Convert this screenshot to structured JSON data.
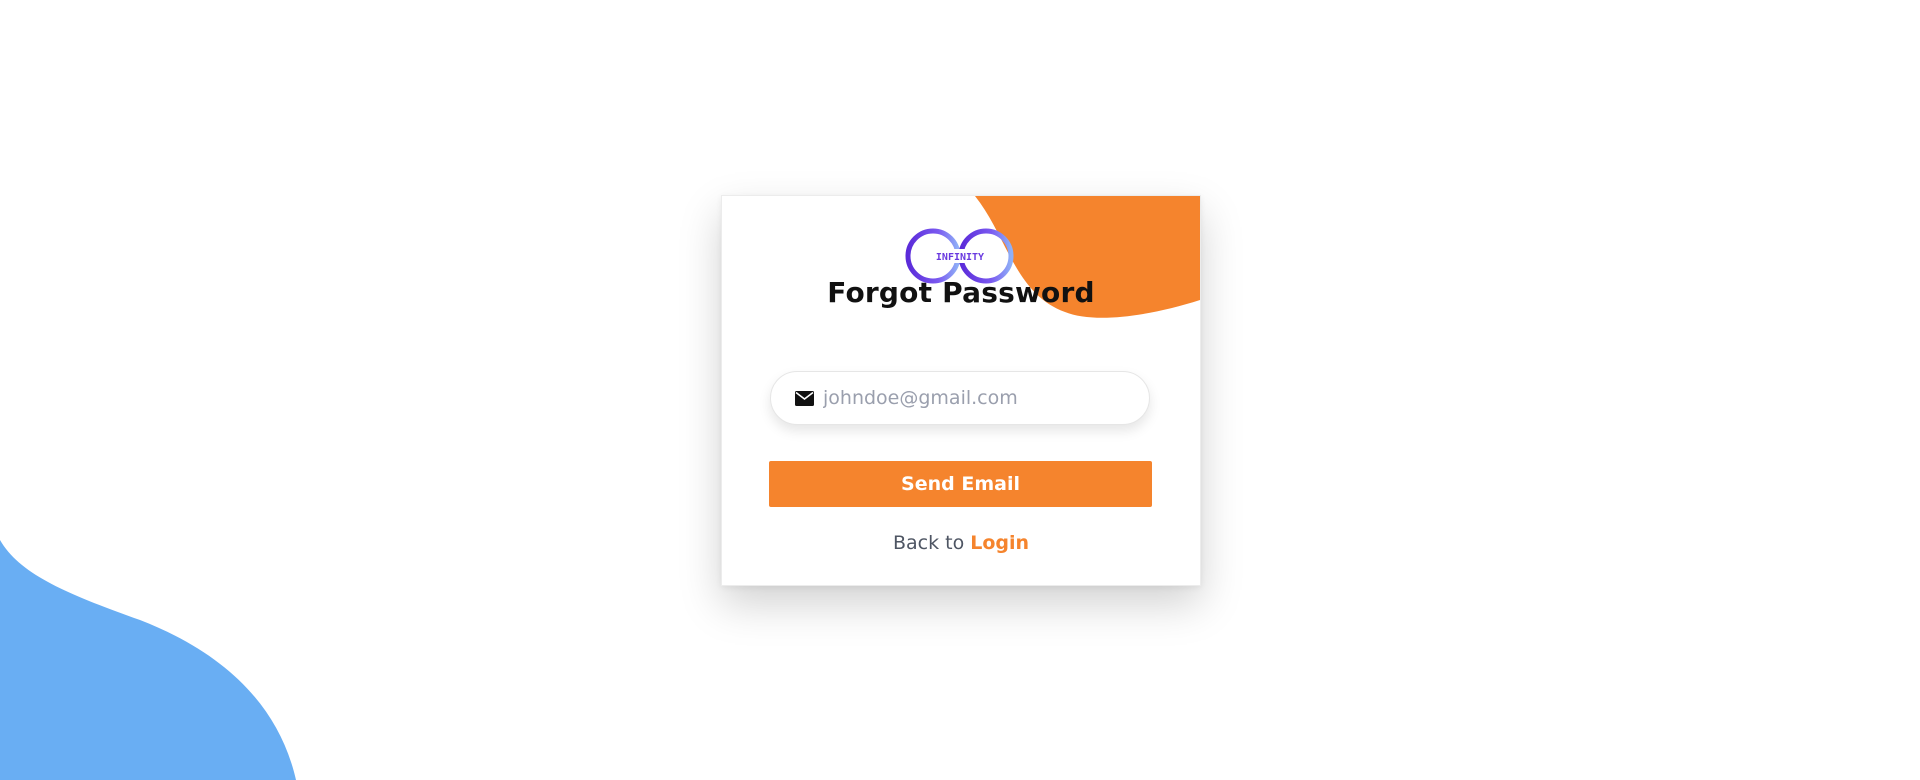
{
  "logo": {
    "text": "INFINITY",
    "colors": [
      "#5b2bd9",
      "#7a59f0",
      "#8fb0f7"
    ]
  },
  "title": "Forgot Password",
  "email_field": {
    "placeholder": "johndoe@gmail.com",
    "value": "",
    "icon": "envelope-icon"
  },
  "send_button": {
    "label": "Send Email"
  },
  "back": {
    "prefix": "Back to ",
    "link_label": "Login"
  },
  "colors": {
    "accent_orange": "#f5842d",
    "blob_blue": "#69aef3",
    "card_background": "#ffffff"
  }
}
